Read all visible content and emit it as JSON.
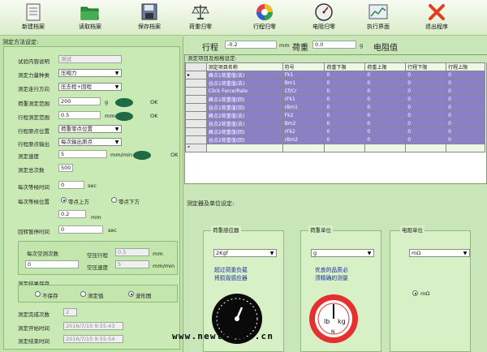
{
  "toolbar": {
    "items": [
      {
        "label": "新建档案",
        "icon": "new-file-icon"
      },
      {
        "label": "读取档案",
        "icon": "open-folder-icon"
      },
      {
        "label": "保存档案",
        "icon": "save-disk-icon"
      },
      {
        "label": "荷重归零",
        "icon": "balance-scale-icon"
      },
      {
        "label": "行程归零",
        "icon": "color-wheel-icon"
      },
      {
        "label": "电阻归零",
        "icon": "gauge-icon"
      },
      {
        "label": "执行界面",
        "icon": "chart-window-icon"
      },
      {
        "label": "退出程序",
        "icon": "exit-x-icon"
      }
    ]
  },
  "left": {
    "title": "测定方法设定:",
    "test_desc_label": "试验内容说明",
    "test_desc_value": "测试",
    "load_type_label": "测定力量种类",
    "load_type_value": "压缩力",
    "direction_label": "测定走行方向",
    "direction_value": "压去程+回程",
    "load_range_label": "荷重测定范围",
    "load_range_value": "200",
    "load_range_unit": "g",
    "load_ok": "OK",
    "stroke_range_label": "行程测定范围",
    "stroke_range_value": "0.5",
    "stroke_range_unit": "mm",
    "stroke_ok": "OK",
    "origin_pos_label": "行程原点位置",
    "origin_pos_value": "荷重零点位置",
    "origin_out_label": "行程原点输出",
    "origin_out_value": "每次输出原点",
    "speed_label": "测定速度",
    "speed_value": "5",
    "speed_unit": "mm/min",
    "speed_ok": "OK",
    "count_label": "测定总次数",
    "count_value": "500",
    "wait_label": "每次等候时间",
    "wait_value": "0",
    "wait_unit": "sec",
    "wait_pos_label": "每次等候位置",
    "wait_pos_opt1": "零点上方",
    "wait_pos_opt2": "零点下方",
    "offset_value": "0.2",
    "offset_unit": "mm",
    "return_label": "回转暂停时间",
    "return_value": "0",
    "return_unit": "sec",
    "idle_count_label": "每次空测次数",
    "idle_count_value": "0",
    "idle_stroke_label": "空压行程",
    "idle_stroke_value": "0.5",
    "idle_stroke_unit": "mm",
    "idle_speed_label": "空压速度",
    "idle_speed_value": "5",
    "idle_speed_unit": "mm/min",
    "save_title": "测定结果保存",
    "save_opt1": "不保存",
    "save_opt2": "测定值",
    "save_opt3": "波形图",
    "done_label": "测定完成次数",
    "done_value": "2",
    "start_label": "测定开始时间",
    "start_value": "2016/7/15 9:55:43",
    "end_label": "测定结束时间",
    "end_value": "2016/7/15 9:55:54"
  },
  "readout": {
    "stroke_label": "行程",
    "stroke_value": "-0.2",
    "stroke_unit": "mm",
    "load_label": "荷重",
    "load_value": "0.0",
    "load_unit": "g",
    "res_label": "电阻值"
  },
  "table": {
    "title": "测定项目及规格设定:",
    "headers": [
      "测定项目名称",
      "符号",
      "荷重下限",
      "荷重上限",
      "行程下限",
      "行程上限"
    ],
    "rows": [
      [
        "峰点1荷重值(去)",
        "Fk1",
        "0",
        "0",
        "0",
        "0"
      ],
      [
        "谷点1荷重值(去)",
        "Bm1",
        "0",
        "0",
        "0",
        "0"
      ],
      [
        "Click Force/Rate",
        "Cf/Cr",
        "0",
        "0",
        "0",
        "0"
      ],
      [
        "峰点1荷重值(回)",
        "rFk1",
        "0",
        "0",
        "0",
        "0"
      ],
      [
        "谷点1荷重值(回)",
        "rBm1",
        "0",
        "0",
        "0",
        "0"
      ],
      [
        "峰点2荷重值(去)",
        "Fk2",
        "0",
        "0",
        "0",
        "0"
      ],
      [
        "谷点2荷重值(去)",
        "Bm2",
        "0",
        "0",
        "0",
        "0"
      ],
      [
        "峰点2荷重值(回)",
        "rFk2",
        "0",
        "0",
        "0",
        "0"
      ],
      [
        "谷点2荷重值(回)",
        "rBm2",
        "0",
        "0",
        "0",
        "0"
      ]
    ],
    "new_row_marker": "*"
  },
  "units": {
    "title": "测定器及单位设定:",
    "sensor_title": "荷重感应器",
    "sensor_value": "2Kgf",
    "sensor_desc1": "超过荷重负载",
    "sensor_desc2": "将损毁感应器",
    "load_unit_title": "荷重单位",
    "load_unit_value": "g",
    "load_unit_desc1": "优良的品质必",
    "load_unit_desc2": "须精确的测量",
    "res_unit_title": "电阻单位",
    "res_unit_value": "mΩ",
    "res_unit_radio": "mΩ"
  },
  "watermark": "www.newtrends.cn",
  "colors": {
    "bg": "#c9e6b8",
    "row": "#8b7fc8",
    "oval": "#1e6b46",
    "blue_text": "#1a2fa0"
  }
}
